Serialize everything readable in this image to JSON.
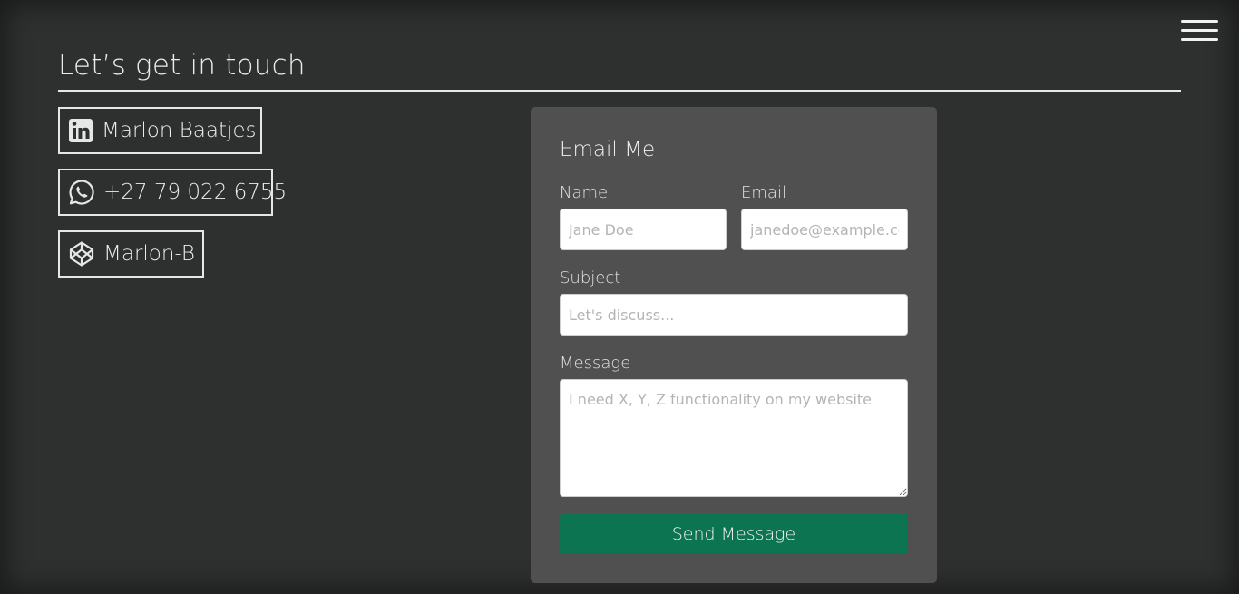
{
  "header": {
    "menu_icon": "hamburger-menu-icon",
    "title": "Let’s get in touch"
  },
  "contacts": [
    {
      "icon": "linkedin-icon",
      "label": "Marlon Baatjes"
    },
    {
      "icon": "whatsapp-icon",
      "label": "+27 79 022 6755"
    },
    {
      "icon": "codepen-icon",
      "label": "Marlon-B"
    }
  ],
  "form": {
    "heading": "Email Me",
    "name": {
      "label": "Name",
      "placeholder": "Jane Doe",
      "value": ""
    },
    "email": {
      "label": "Email",
      "placeholder": "janedoe@example.com",
      "value": ""
    },
    "subject": {
      "label": "Subject",
      "placeholder": "Let's discuss...",
      "value": ""
    },
    "message": {
      "label": "Message",
      "placeholder": "I need X, Y, Z functionality on my website",
      "value": ""
    },
    "submit_label": "Send Message"
  },
  "colors": {
    "background": "#2e2f2f",
    "card": "#505050",
    "accent_button": "#0d7451",
    "text": "#ececec"
  }
}
